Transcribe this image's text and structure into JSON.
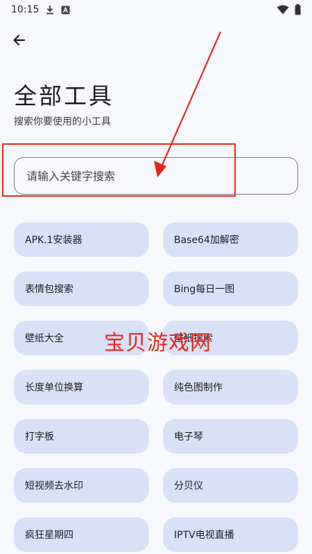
{
  "status_bar": {
    "time": "10:15",
    "icons": [
      "download-icon",
      "a-notification-icon",
      "wifi-icon",
      "battery-icon"
    ]
  },
  "header": {
    "back_icon": "arrow-left-icon",
    "title": "全部工具",
    "subtitle": "搜索你要使用的小工具"
  },
  "search": {
    "placeholder": "请输入关键字搜索",
    "value": ""
  },
  "tools": [
    {
      "label": "APK.1安装器"
    },
    {
      "label": "Base64加解密"
    },
    {
      "label": "表情包搜索"
    },
    {
      "label": "Bing每日一图"
    },
    {
      "label": "壁纸大全"
    },
    {
      "label": "壁纸搜索"
    },
    {
      "label": "长度单位换算"
    },
    {
      "label": "纯色图制作"
    },
    {
      "label": "打字板"
    },
    {
      "label": "电子琴"
    },
    {
      "label": "短视频去水印"
    },
    {
      "label": "分贝仪"
    },
    {
      "label": "疯狂星期四"
    },
    {
      "label": "IPTV电视直播"
    }
  ],
  "watermark": "宝贝游戏网",
  "colors": {
    "background": "#f7f8fc",
    "tool_button_bg": "#d9e1f7",
    "annotation_red": "#e8261c"
  }
}
